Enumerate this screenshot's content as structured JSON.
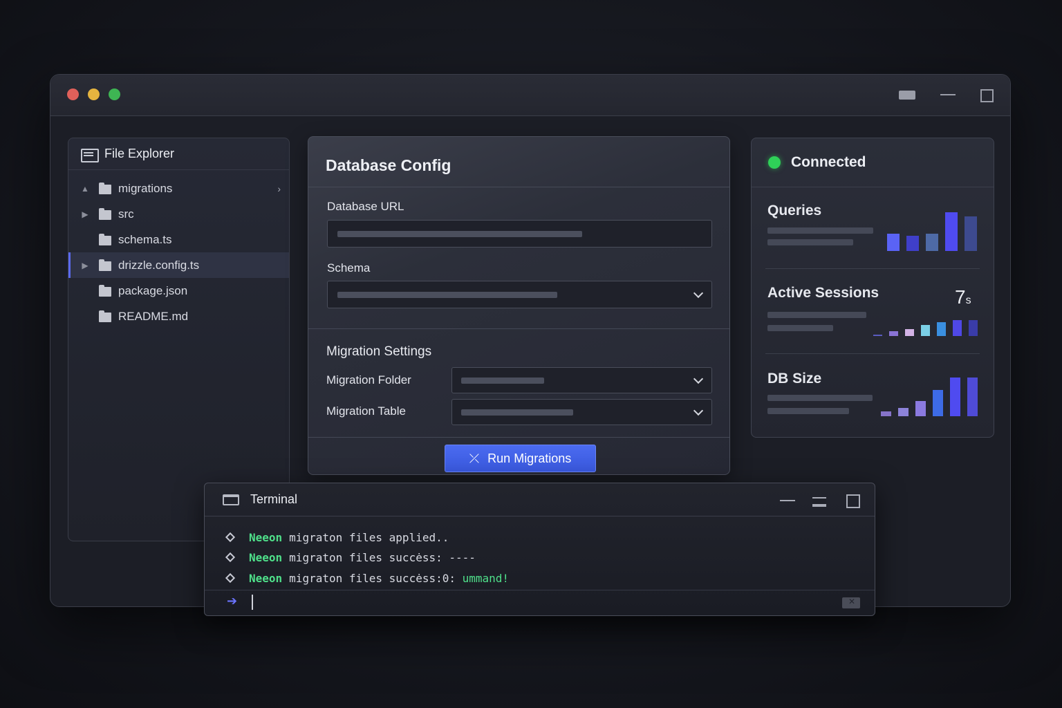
{
  "explorer": {
    "title": "File Explorer",
    "items": [
      {
        "label": "migrations",
        "arrow": "▲"
      },
      {
        "label": "src",
        "arrow": "▶"
      },
      {
        "label": "schema.ts",
        "arrow": ""
      },
      {
        "label": "drizzle.config.ts",
        "arrow": "▶"
      },
      {
        "label": "package.json",
        "arrow": ""
      },
      {
        "label": "README.md",
        "arrow": ""
      }
    ]
  },
  "db_config": {
    "title": "Database Config",
    "url_label": "Database URL",
    "schema_label": "Schema",
    "migration_settings_title": "Migration Settings",
    "migration_folder_label": "Migration Folder",
    "migration_table_label": "Migration Table",
    "run_button": "Run Migrations"
  },
  "status": {
    "state": "Connected",
    "state_color": "#2fd058",
    "metrics": [
      {
        "title": "Queries",
        "bars": [
          0.45,
          0.4,
          0.45,
          1.0,
          0.89
        ],
        "colors": [
          "#5a63f5",
          "#3f3fc9",
          "#4e6aa6",
          "#4f4bf0",
          "#3d4a8f"
        ]
      },
      {
        "title": "Active Sessions",
        "value": "7",
        "value_unit": "s",
        "bars": [
          0.04,
          0.27,
          0.38,
          0.62,
          0.77,
          0.9,
          0.9
        ],
        "colors": [
          "#5a5cc0",
          "#8a74d6",
          "#d3b3e6",
          "#7bcfe6",
          "#3a8fe0",
          "#4f48e6",
          "#3a3ca8"
        ]
      },
      {
        "title": "DB Size",
        "bars": [
          0.13,
          0.22,
          0.4,
          0.68,
          1.0,
          1.0
        ],
        "colors": [
          "#8673c9",
          "#8d83d9",
          "#8b7ae0",
          "#3d6be6",
          "#4f4bf0",
          "#4f4bd6"
        ]
      }
    ]
  },
  "terminal": {
    "title": "Terminal",
    "lines": [
      {
        "keyword": "Neeon",
        "text": "migraton files applied..",
        "highlight": ""
      },
      {
        "keyword": "Neeon",
        "text": "migraton files succėss: ----",
        "highlight": ""
      },
      {
        "keyword": "Neeon",
        "text": "migraton files succėss:0: ",
        "highlight": "ummand!"
      }
    ],
    "prompt": "➔"
  }
}
